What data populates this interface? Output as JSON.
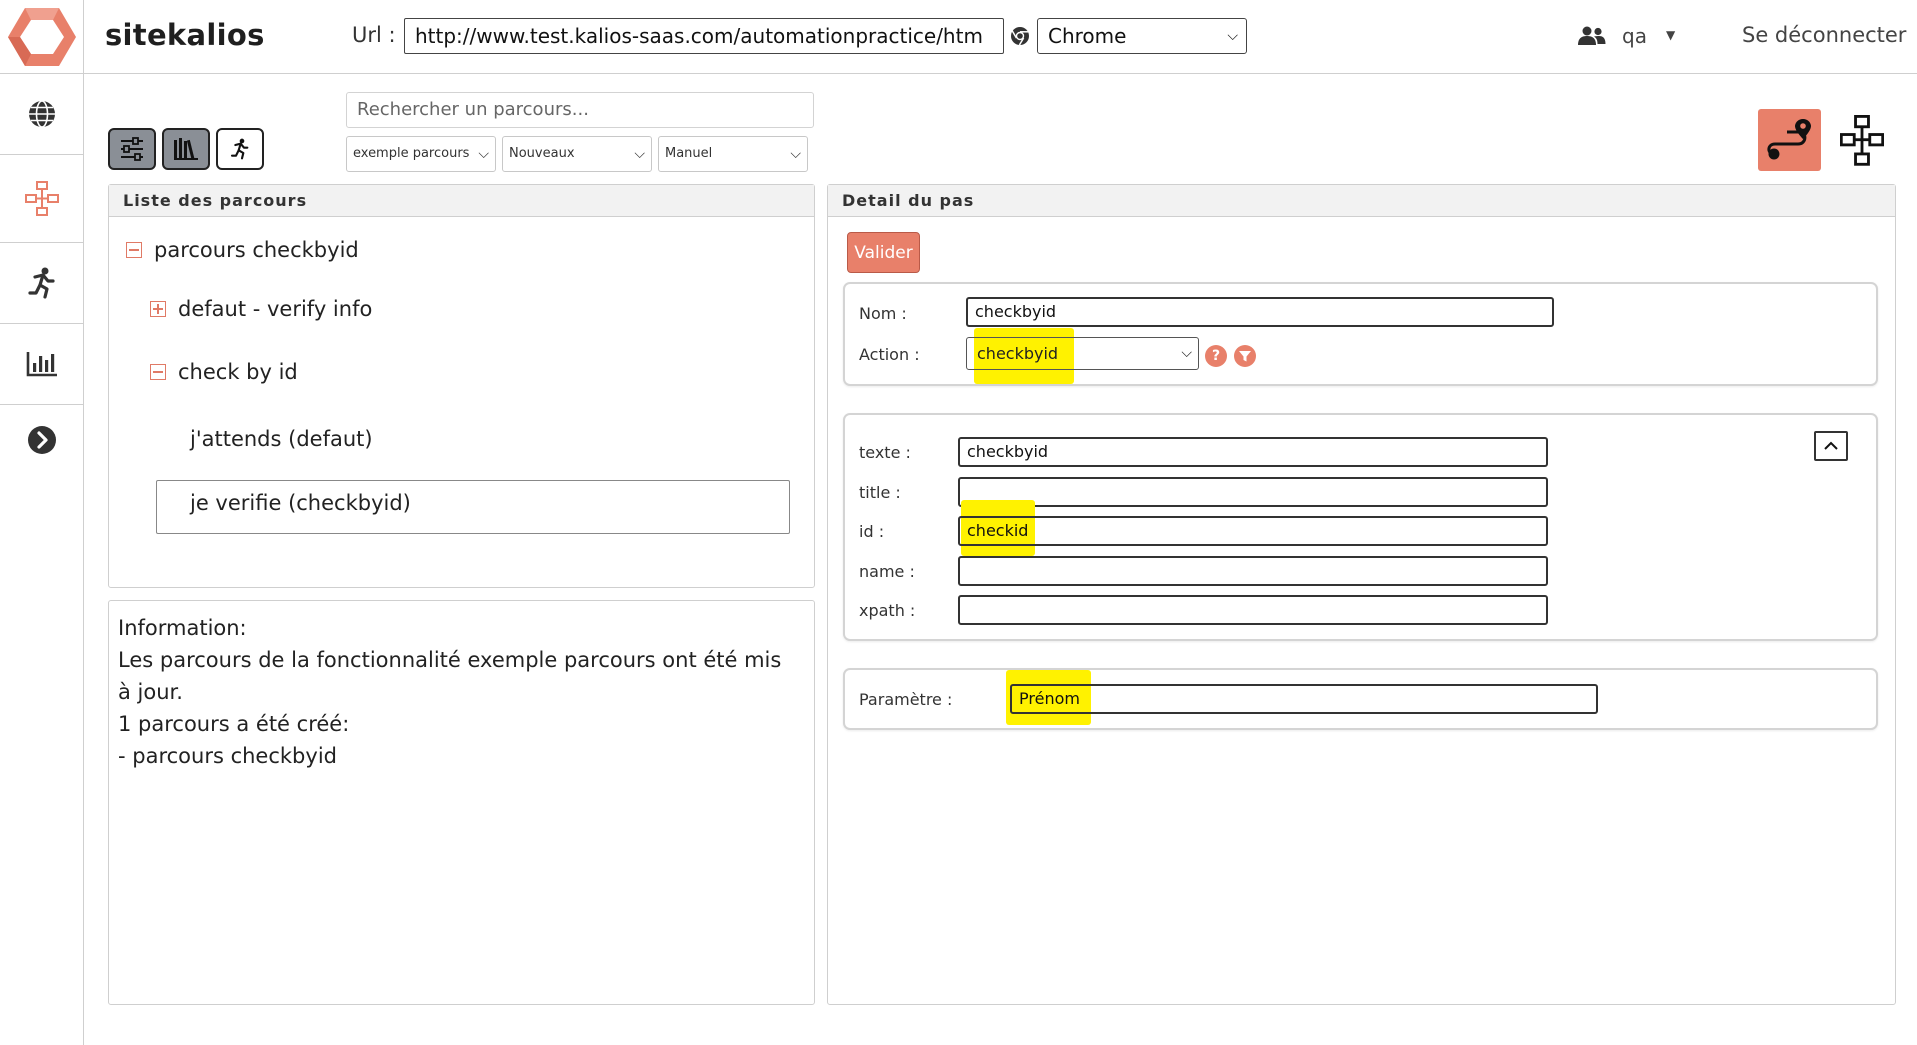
{
  "header": {
    "brand": "sitekalios",
    "url_label": "Url :",
    "url_value": "http://www.test.kalios-saas.com/automationpractice/htm",
    "browser_value": "Chrome",
    "user_name": "qa",
    "logout_label": "Se déconnecter"
  },
  "sidebar": {
    "items": [
      {
        "icon": "globe-icon"
      },
      {
        "icon": "sitemap-icon"
      },
      {
        "icon": "running-icon"
      },
      {
        "icon": "chart-icon"
      },
      {
        "icon": "chevron-right-icon"
      }
    ]
  },
  "toolbar": {
    "search_placeholder": "Rechercher un parcours...",
    "filter_feature": "exemple parcours",
    "filter_status": "Nouveaux",
    "filter_mode": "Manuel"
  },
  "list_panel": {
    "title": "Liste des parcours",
    "tree": [
      {
        "label": "parcours checkbyid",
        "toggle": "minus"
      },
      {
        "label": "defaut - verify info",
        "toggle": "plus"
      },
      {
        "label": "check by id",
        "toggle": "minus"
      },
      {
        "label": "j'attends (defaut)"
      },
      {
        "label": "je verifie (checkbyid)",
        "selected": true
      }
    ]
  },
  "info_panel": {
    "lines": [
      "Information:",
      "Les parcours de la fonctionnalité exemple parcours ont été mis",
      "à jour.",
      "1 parcours a été créé:",
      "- parcours checkbyid"
    ]
  },
  "detail_panel": {
    "title": "Detail du pas",
    "valider_label": "Valider",
    "nom_label": "Nom :",
    "nom_value": "checkbyid",
    "action_label": "Action :",
    "action_value": "checkbyid",
    "help_icon": "?",
    "fields": [
      {
        "label": "texte :",
        "value": "checkbyid"
      },
      {
        "label": "title :",
        "value": ""
      },
      {
        "label": "id :",
        "value": "checkid"
      },
      {
        "label": "name :",
        "value": ""
      },
      {
        "label": "xpath :",
        "value": ""
      }
    ],
    "parametre_label": "Paramètre :",
    "parametre_value": "Prénom"
  },
  "colors": {
    "accent": "#e8806a",
    "highlight": "#fff200"
  }
}
